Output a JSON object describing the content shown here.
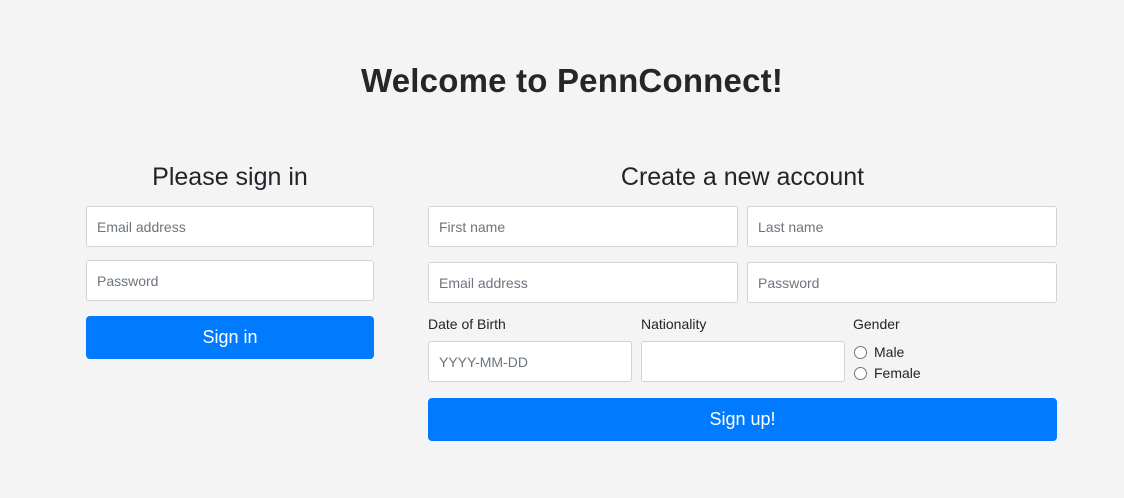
{
  "header": {
    "title": "Welcome to PennConnect!"
  },
  "signin": {
    "heading": "Please sign in",
    "email_placeholder": "Email address",
    "password_placeholder": "Password",
    "button_label": "Sign in"
  },
  "signup": {
    "heading": "Create a new account",
    "first_name_placeholder": "First name",
    "last_name_placeholder": "Last name",
    "email_placeholder": "Email address",
    "password_placeholder": "Password",
    "dob_label": "Date of Birth",
    "dob_placeholder": "YYYY-MM-DD",
    "nationality_label": "Nationality",
    "nationality_placeholder": "",
    "gender_label": "Gender",
    "gender_options": [
      "Male",
      "Female"
    ],
    "button_label": "Sign up!"
  }
}
